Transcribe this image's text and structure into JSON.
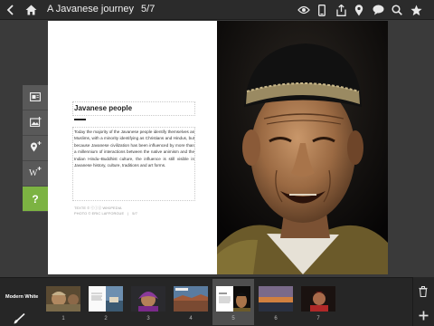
{
  "topbar": {
    "title": "A Javanese journey",
    "counter": "5/7",
    "icons": [
      "back-chevron-icon",
      "home-icon",
      "eye-icon",
      "phone-icon",
      "share-icon",
      "location-pin-icon",
      "speech-bubble-icon",
      "search-icon",
      "star-icon"
    ]
  },
  "page": {
    "heading": "Javanese people",
    "body": "Today the majority of the Javanese people identify themselves as Muslims, with a minority identifying as Christians and Hindus, but because Javanese civilization has been influenced by more than a millennium of interactions between the native animism and the Indian Hindu–Buddhist culture, the influence is still visible in Javanese history, culture, traditions and art forms.",
    "credit_text": "TEXTE © ⓒⓘⓢ WIKIPEDIA",
    "credit_photo": "PHOTO © ERIC LAFFORGUE",
    "credit_page": "5/7"
  },
  "tools": [
    {
      "name": "text-layout-tool",
      "icon": "text-box-icon"
    },
    {
      "name": "image-tool",
      "icon": "image-add-icon"
    },
    {
      "name": "location-tool",
      "icon": "pin-add-icon"
    },
    {
      "name": "wikipedia-tool",
      "icon": "wikipedia-icon"
    },
    {
      "name": "help-tool",
      "label": "?"
    }
  ],
  "bottom": {
    "theme": "Modern White",
    "pages": [
      "1",
      "2",
      "3",
      "4",
      "5",
      "6",
      "7"
    ],
    "active_page": 5
  },
  "colors": {
    "accent_green": "#7cb342",
    "topbar_bg": "#2b2b2b",
    "bottom_bg": "#262626"
  }
}
